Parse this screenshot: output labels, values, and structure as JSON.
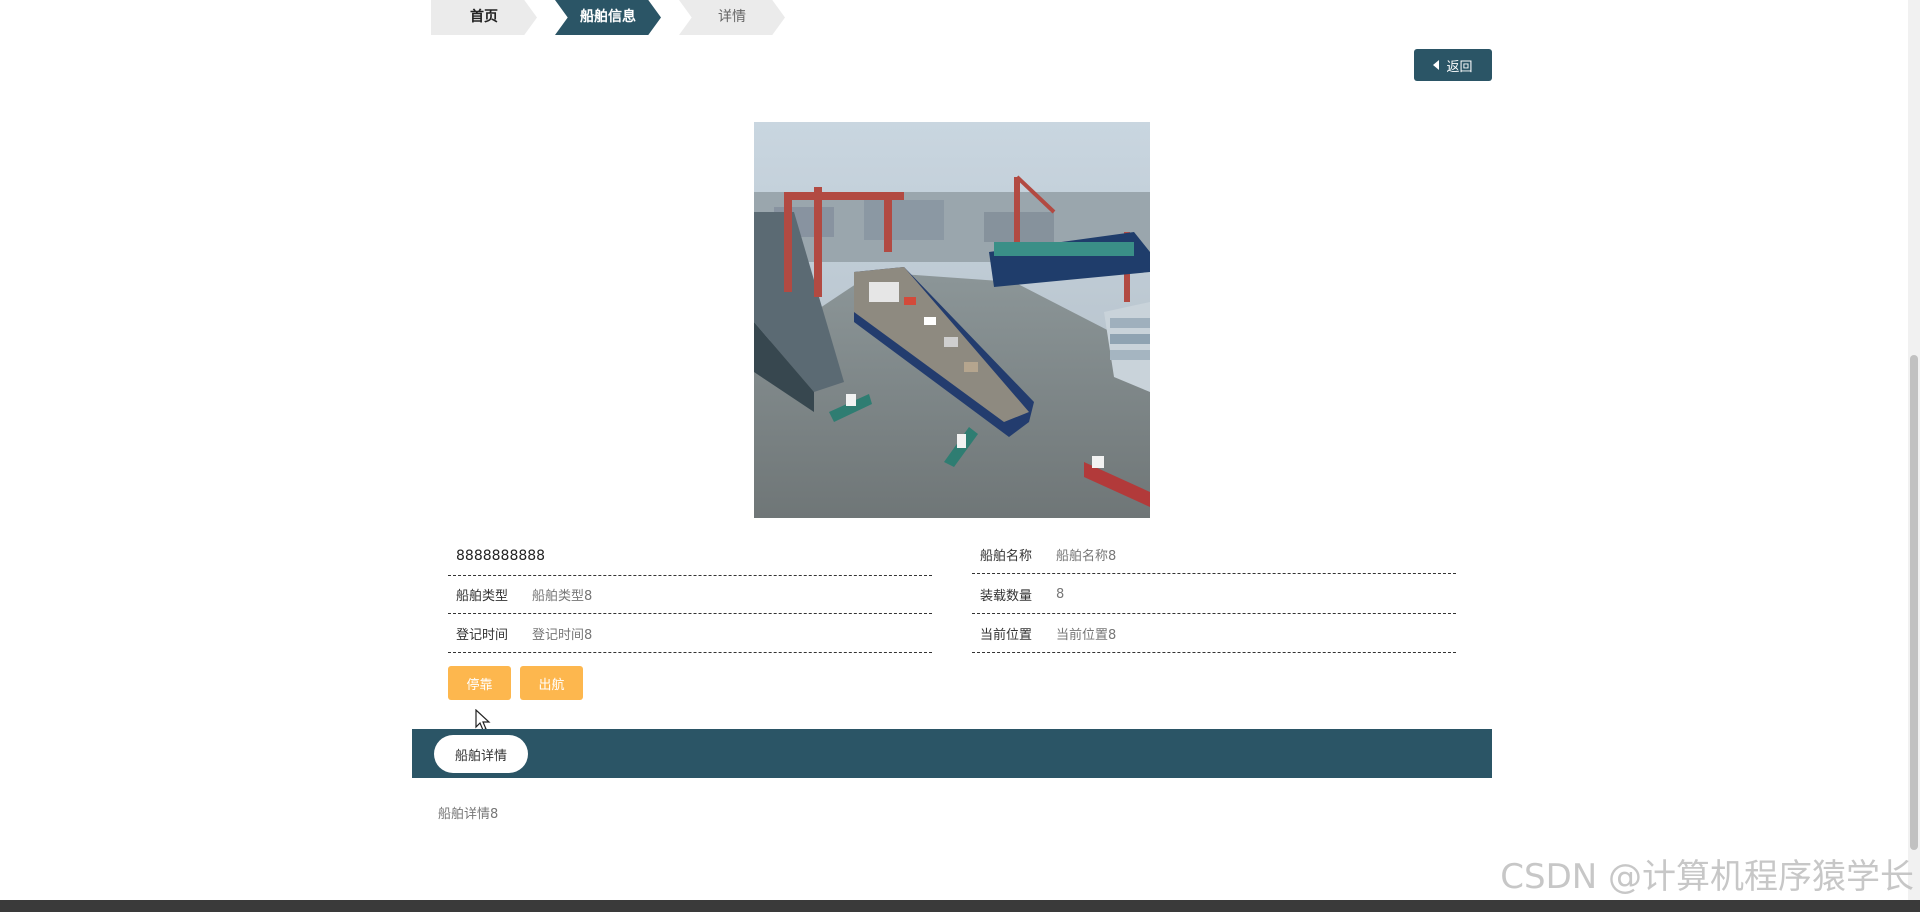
{
  "breadcrumb": {
    "items": [
      "首页",
      "船舶信息",
      "详情"
    ]
  },
  "back_button": {
    "label": "返回"
  },
  "ship": {
    "id_value": "8888888888",
    "fields": [
      {
        "label": "船舶名称",
        "value": "船舶名称8"
      },
      {
        "label": "船舶类型",
        "value": "船舶类型8"
      },
      {
        "label": "装载数量",
        "value": "8"
      },
      {
        "label": "登记时间",
        "value": "登记时间8"
      },
      {
        "label": "当前位置",
        "value": "当前位置8"
      }
    ]
  },
  "actions": {
    "dock_label": "停靠",
    "depart_label": "出航"
  },
  "detail_tab": {
    "label": "船舶详情"
  },
  "detail_content": "船舶详情8",
  "watermark": "CSDN @计算机程序猿学长",
  "colors": {
    "primary": "#2b5566",
    "accent": "#fdb74e",
    "crumb_bg": "#ebebeb"
  }
}
